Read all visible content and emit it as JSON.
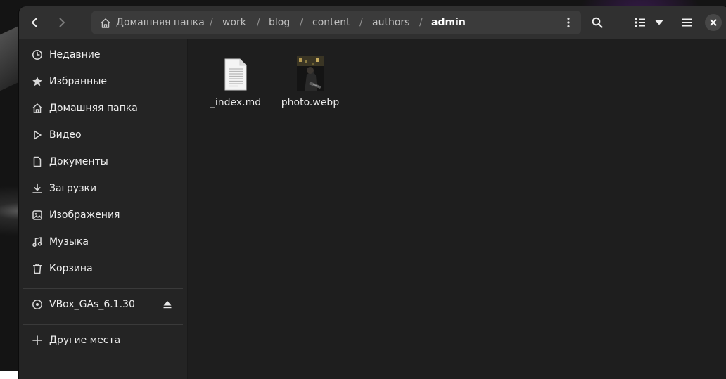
{
  "breadcrumb": [
    "Домашняя папка",
    "work",
    "blog",
    "content",
    "authors",
    "admin"
  ],
  "sidebar": {
    "places": [
      {
        "label": "Недавние",
        "icon": "clock-icon"
      },
      {
        "label": "Избранные",
        "icon": "star-icon"
      },
      {
        "label": "Домашняя папка",
        "icon": "home-icon"
      },
      {
        "label": "Видео",
        "icon": "video-icon"
      },
      {
        "label": "Документы",
        "icon": "document-icon"
      },
      {
        "label": "Загрузки",
        "icon": "download-icon"
      },
      {
        "label": "Изображения",
        "icon": "image-icon"
      },
      {
        "label": "Музыка",
        "icon": "music-icon"
      },
      {
        "label": "Корзина",
        "icon": "trash-icon"
      }
    ],
    "devices": [
      {
        "label": "VBox_GAs_6.1.30",
        "icon": "disc-icon"
      }
    ],
    "other": {
      "label": "Другие места",
      "icon": "plus-icon"
    }
  },
  "files": [
    {
      "name": "_index.md",
      "icon": "text-file-icon"
    },
    {
      "name": "photo.webp",
      "icon": "image-thumbnail"
    }
  ],
  "colors": {
    "window_bg": "#242424",
    "headerbar_bg": "#303030",
    "content_bg": "#1e1e1e",
    "text": "#eeeeee"
  }
}
